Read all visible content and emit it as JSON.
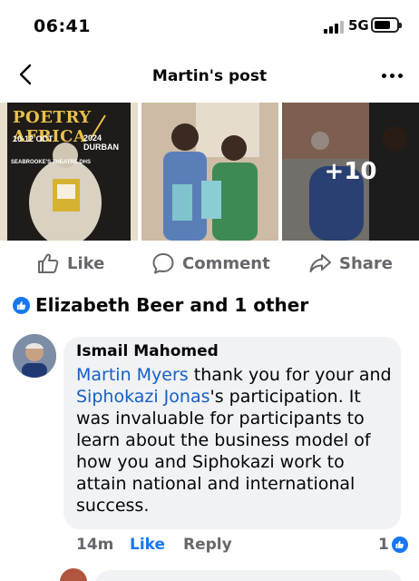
{
  "status_bar": {
    "time": "06:41",
    "network": "5G"
  },
  "header": {
    "title": "Martin's post"
  },
  "photos": {
    "poster": {
      "title": "POETRY AFRICA",
      "date": "10-12 OCT",
      "venue": "SEABROOKE'S THEATRE DHS",
      "city": "2024 DURBAN"
    },
    "more_count": "+10"
  },
  "actions": {
    "like": "Like",
    "comment": "Comment",
    "share": "Share"
  },
  "reactions": {
    "text": "Elizabeth Beer and 1 other"
  },
  "comment": {
    "author": "Ismail Mahomed",
    "mention_1": "Martin Myers",
    "text_1": " thank you for your and ",
    "mention_2": "Siphokazi Jonas",
    "text_2": "'s participation. It was invaluable for participants to learn about the business model of how you and Siphokazi work to attain national and international success.",
    "time": "14m",
    "like_label": "Like",
    "reply_label": "Reply",
    "like_count": "1"
  },
  "colors": {
    "accent": "#1877f2",
    "mention": "#1560c9",
    "bubble": "#f0f2f5",
    "muted": "#65676b"
  }
}
